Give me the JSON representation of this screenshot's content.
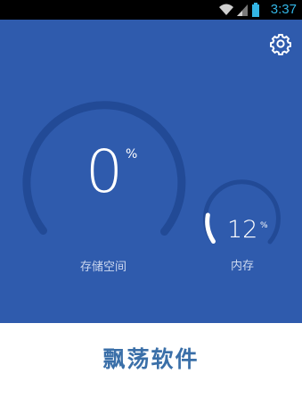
{
  "status_bar": {
    "time": "3:37",
    "icons": [
      "wifi-icon",
      "signal-icon",
      "battery-icon"
    ],
    "time_color": "#33b5e5"
  },
  "toolbar": {
    "settings_icon": "gear-icon"
  },
  "storage": {
    "value": "0",
    "unit": "%",
    "label": "存储空间",
    "level": 0
  },
  "memory": {
    "value": "12",
    "unit": "%",
    "label": "内存",
    "level": 12
  },
  "watermark": {
    "text": "飘荡软件",
    "color": "#3a6fa8"
  },
  "theme": {
    "background": "#2f5bad",
    "track": "#224a96",
    "progress": "#ffffff"
  }
}
